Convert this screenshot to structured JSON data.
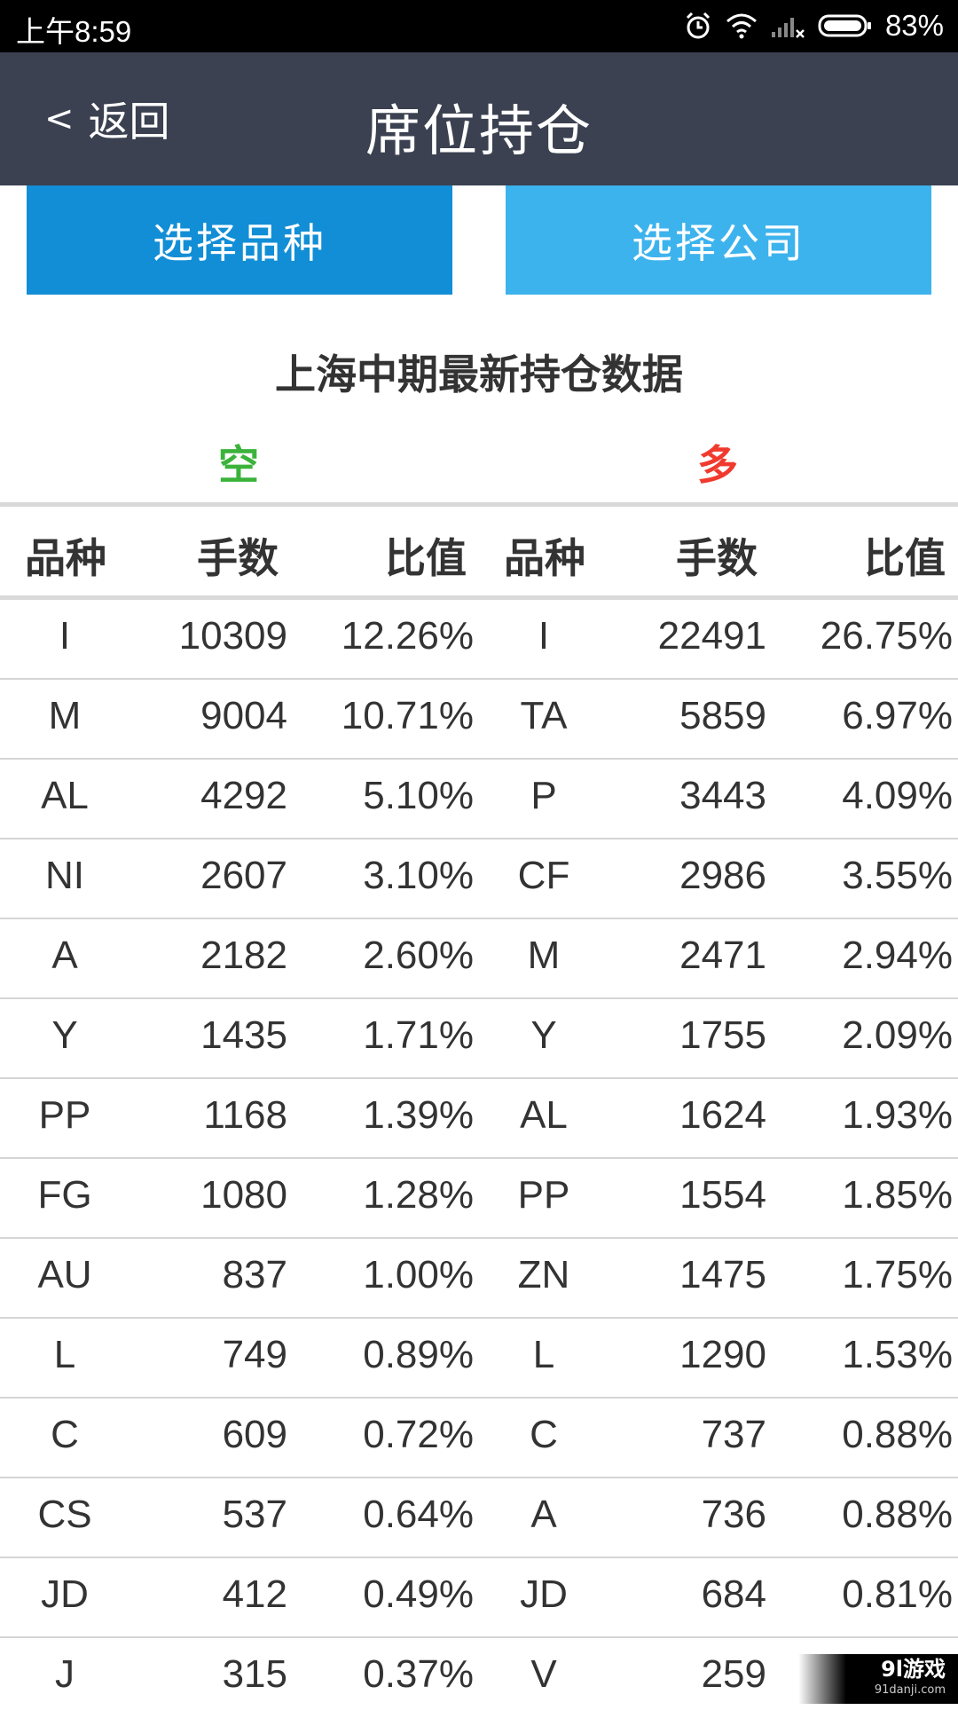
{
  "status": {
    "time": "上午8:59",
    "battery": "83%"
  },
  "header": {
    "back_label": "返回",
    "back_glyph": "<",
    "title": "席位持仓"
  },
  "buttons": {
    "select_variety": "选择品种",
    "select_company": "选择公司"
  },
  "data_title": "上海中期最新持仓数据",
  "sides": {
    "short": "空",
    "long": "多",
    "short_color": "#3bb33b",
    "long_color": "#f03a2e"
  },
  "columns": [
    "品种",
    "手数",
    "比值",
    "品种",
    "手数",
    "比值"
  ],
  "rows": [
    [
      "I",
      "10309",
      "12.26%",
      "I",
      "22491",
      "26.75%"
    ],
    [
      "M",
      "9004",
      "10.71%",
      "TA",
      "5859",
      "6.97%"
    ],
    [
      "AL",
      "4292",
      "5.10%",
      "P",
      "3443",
      "4.09%"
    ],
    [
      "NI",
      "2607",
      "3.10%",
      "CF",
      "2986",
      "3.55%"
    ],
    [
      "A",
      "2182",
      "2.60%",
      "M",
      "2471",
      "2.94%"
    ],
    [
      "Y",
      "1435",
      "1.71%",
      "Y",
      "1755",
      "2.09%"
    ],
    [
      "PP",
      "1168",
      "1.39%",
      "AL",
      "1624",
      "1.93%"
    ],
    [
      "FG",
      "1080",
      "1.28%",
      "PP",
      "1554",
      "1.85%"
    ],
    [
      "AU",
      "837",
      "1.00%",
      "ZN",
      "1475",
      "1.75%"
    ],
    [
      "L",
      "749",
      "0.89%",
      "L",
      "1290",
      "1.53%"
    ],
    [
      "C",
      "609",
      "0.72%",
      "C",
      "737",
      "0.88%"
    ],
    [
      "CS",
      "537",
      "0.64%",
      "A",
      "736",
      "0.88%"
    ],
    [
      "JD",
      "412",
      "0.49%",
      "JD",
      "684",
      "0.81%"
    ],
    [
      "J",
      "315",
      "0.37%",
      "V",
      "259",
      ""
    ]
  ],
  "watermark": {
    "brand": "9l游戏",
    "site": "91danji.com"
  },
  "colors": {
    "header_bg": "#3b4150",
    "btn_left": "#128ed6",
    "btn_right": "#3db3ed"
  }
}
